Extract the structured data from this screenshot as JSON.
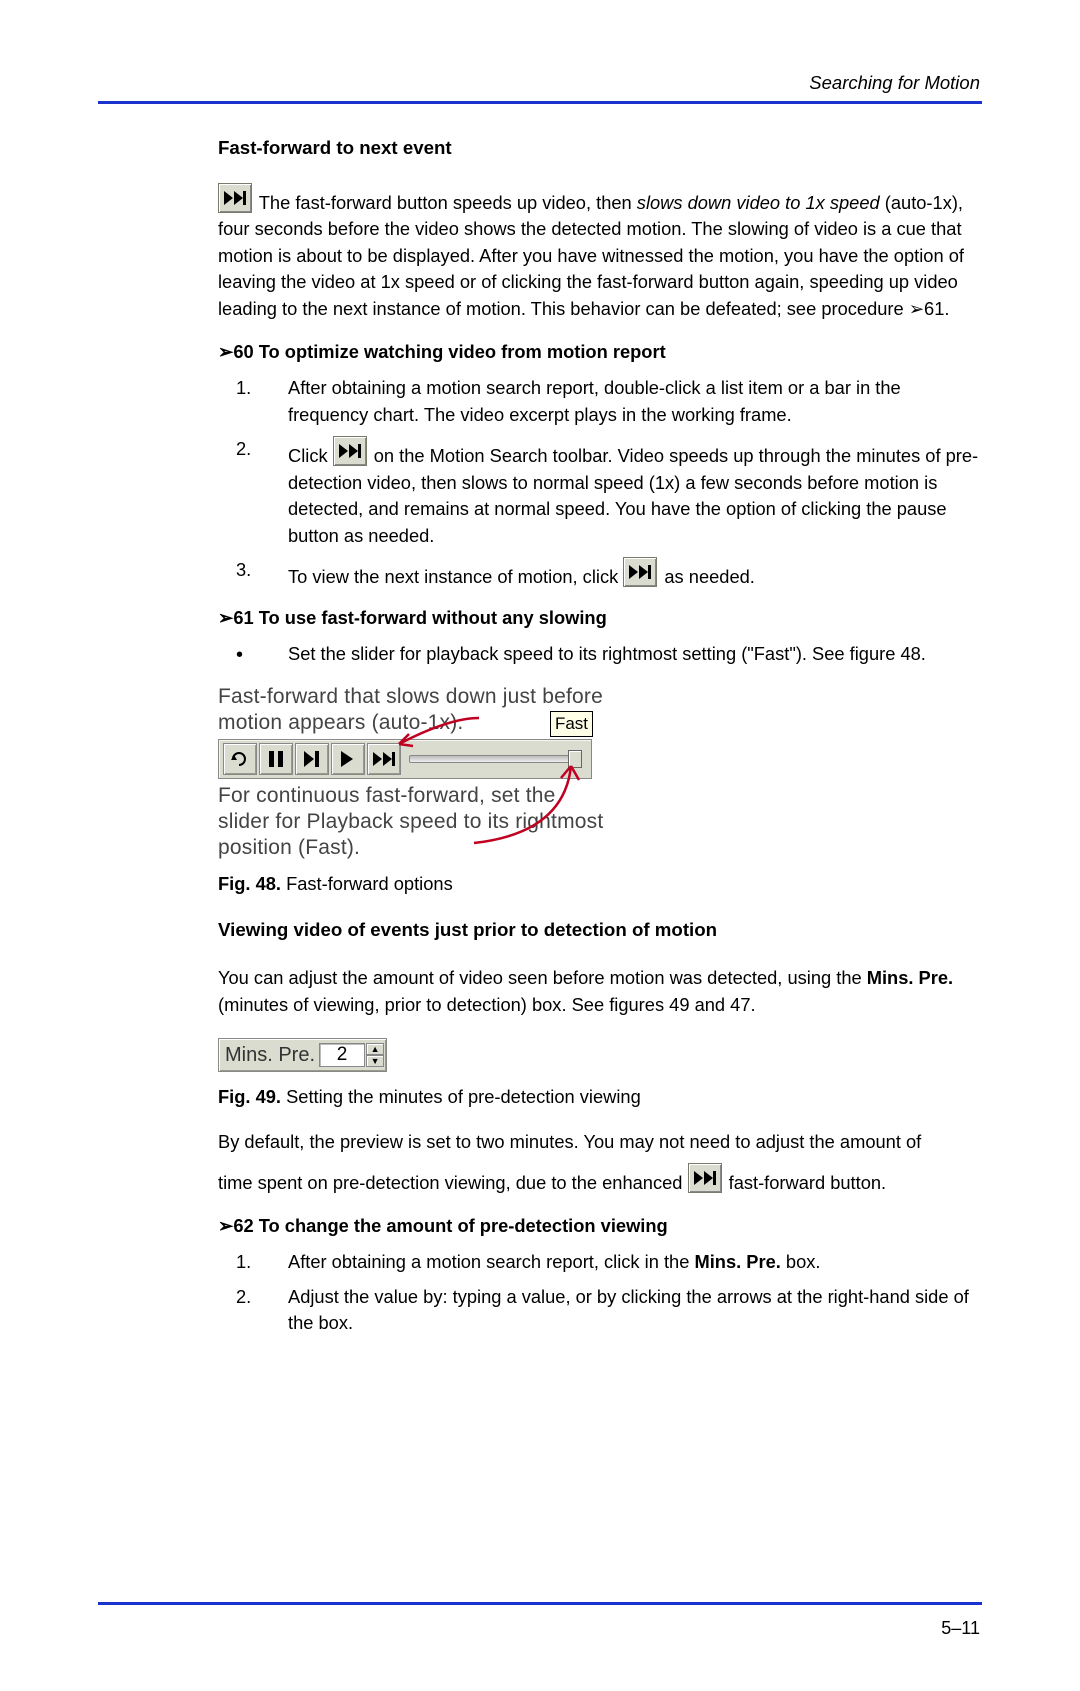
{
  "header": {
    "section": "Searching for Motion"
  },
  "headings": {
    "h1": "Fast-forward to next event",
    "h2": "Viewing video of events just prior to detection of motion"
  },
  "intro": {
    "p1a": "The fast-forward button speeds up video, then ",
    "p1em": "slows down video to 1x speed",
    "p1b": " (auto-1x), four seconds before the video shows the detected motion. The slowing of video is a cue that motion is about to be displayed. After you have witnessed the motion, you have the option of leaving the video at 1x speed or of clicking the fast-forward button again, speeding up video leading to the next instance of motion. This behavior can be defeated; see procedure ➢61."
  },
  "proc60": {
    "head": "➢60  To optimize watching video from motion report",
    "i1": "After obtaining a motion search report, double-click a list item or a bar in the frequency chart. The video excerpt plays in the working frame.",
    "i2a": "Click ",
    "i2b": " on the Motion Search toolbar. Video speeds up through the minutes of pre-detection video, then slows to normal speed (1x) a few seconds before motion is detected, and remains at normal speed. You have the option of clicking the pause button as needed.",
    "i3a": "To view the next instance of motion, click ",
    "i3b": " as needed."
  },
  "proc61": {
    "head": "➢61  To use fast-forward without any slowing",
    "b1": "Set the slider for playback speed to its rightmost setting (\"Fast\"). See figure 48."
  },
  "fig48": {
    "annot_top": "Fast-forward that slows down just before motion appears (auto-1x).",
    "tooltip": "Fast",
    "annot_bottom": "For continuous fast-forward, set the slider for Playback speed to its rightmost position (Fast).",
    "caption_bold": "Fig. 48.",
    "caption_text": " Fast-forward options"
  },
  "viewing": {
    "p1a": "You can adjust the amount of video seen before motion was detected, using the ",
    "p1b": "Mins. Pre.",
    "p1c": " (minutes of viewing, prior to detection) box. See figures 49 and 47."
  },
  "fig49": {
    "label": "Mins. Pre.",
    "value": "2",
    "caption_bold": "Fig. 49.",
    "caption_text": " Setting the minutes of pre-detection viewing"
  },
  "after49": {
    "p1": "By default, the preview is set to two minutes. You may not need to adjust the amount of",
    "p2a": "time spent on pre-detection viewing, due to the enhanced ",
    "p2b": " fast-forward button."
  },
  "proc62": {
    "head": "➢62  To change the amount of pre-detection viewing",
    "i1a": "After obtaining a motion search report, click in the ",
    "i1b": "Mins. Pre.",
    "i1c": " box.",
    "i2": "Adjust the value by: typing a value, or by clicking the arrows at the right-hand side of the box."
  },
  "footer": {
    "page": "5–11"
  }
}
